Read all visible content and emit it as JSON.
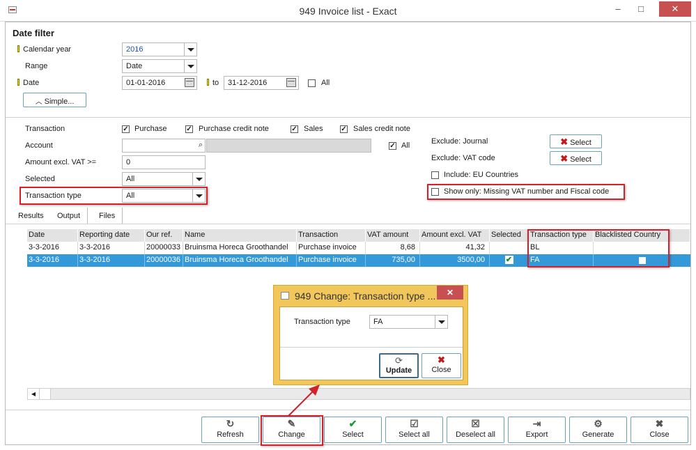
{
  "window": {
    "title": "949 Invoice list - Exact",
    "minimize": "–",
    "maximize": "□",
    "close": "✕"
  },
  "date_filter": {
    "header": "Date filter",
    "calendar_year_label": "Calendar year",
    "calendar_year_value": "2016",
    "range_label": "Range",
    "range_value": "Date",
    "date_label": "Date",
    "date_from": "01-01-2016",
    "to_label": "to",
    "date_to": "31-12-2016",
    "all_label": "All",
    "simple_button": "Simple..."
  },
  "filters": {
    "transaction_label": "Transaction",
    "purchase": "Purchase",
    "purchase_credit_note": "Purchase credit note",
    "sales": "Sales",
    "sales_credit_note": "Sales credit note",
    "account_label": "Account",
    "account_all": "All",
    "amount_label": "Amount excl. VAT >=",
    "amount_value": "0",
    "selected_label": "Selected",
    "selected_value": "All",
    "transaction_type_label": "Transaction type",
    "transaction_type_value": "All",
    "exclude_journal_label": "Exclude: Journal",
    "exclude_vat_label": "Exclude: VAT code",
    "select_button": "Select",
    "include_eu_label": "Include: EU Countries",
    "show_only_label": "Show only: Missing VAT number and Fiscal code"
  },
  "tabs": [
    "Results",
    "Output",
    "Files"
  ],
  "grid": {
    "columns": [
      "Date",
      "Reporting date",
      "Our ref.",
      "Name",
      "Transaction",
      "VAT amount",
      "Amount excl. VAT",
      "Selected",
      "Transaction type",
      "Blacklisted Country"
    ],
    "rows": [
      [
        "3-3-2016",
        "3-3-2016",
        "20000033",
        "Bruinsma Horeca Groothandel",
        "Purchase invoice",
        "8,68",
        "41,32",
        "",
        "BL",
        ""
      ],
      [
        "3-3-2016",
        "3-3-2016",
        "20000036",
        "Bruinsma Horeca Groothandel",
        "Purchase invoice",
        "735,00",
        "3500,00",
        "✔",
        "FA",
        ""
      ]
    ]
  },
  "dialog": {
    "title": "949 Change: Transaction type ...",
    "close": "✕",
    "field_label": "Transaction type",
    "field_value": "FA",
    "update_button": "Update",
    "close_button": "Close"
  },
  "toolbar": {
    "refresh": "Refresh",
    "change": "Change",
    "select": "Select",
    "select_all": "Select all",
    "deselect_all": "Deselect all",
    "export": "Export",
    "generate": "Generate",
    "close": "Close"
  },
  "colors": {
    "selection": "#3399d8",
    "highlight": "#d3202a",
    "dialog_frame": "#f1c65b"
  }
}
